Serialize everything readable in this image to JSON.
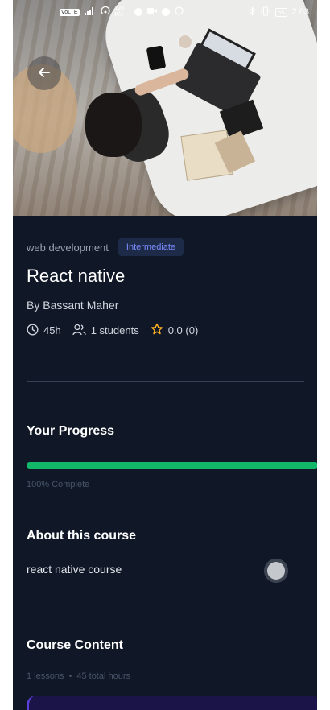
{
  "status_bar": {
    "left_icons": [
      "sim-icon",
      "signal-icon",
      "hotspot-icon",
      "speed-icon",
      "app-icon",
      "video-icon",
      "app-icon",
      "whatsapp-icon"
    ],
    "network_label": "VoLTE",
    "speed_label": "120 K/s",
    "time": "2:03",
    "battery": "65"
  },
  "hero": {
    "image_description_icon": "course-cover-image",
    "back_icon": "arrow-left-icon"
  },
  "course": {
    "category": "web development",
    "level": "Intermediate",
    "title": "React native",
    "author": "By Bassant Maher",
    "duration": "45h",
    "students": "1 students",
    "rating": "0.0 (0)"
  },
  "progress": {
    "heading": "Your Progress",
    "percent": 100,
    "label": "100% Complete"
  },
  "about": {
    "heading": "About this course",
    "text": "react native course"
  },
  "content": {
    "heading": "Course Content",
    "lessons": "1 lessons",
    "separator": "•",
    "hours": "45 total hours"
  },
  "colors": {
    "background": "#101828",
    "progress": "#12b76a",
    "badge_text": "#7b8cff",
    "star": "#fdb022"
  }
}
